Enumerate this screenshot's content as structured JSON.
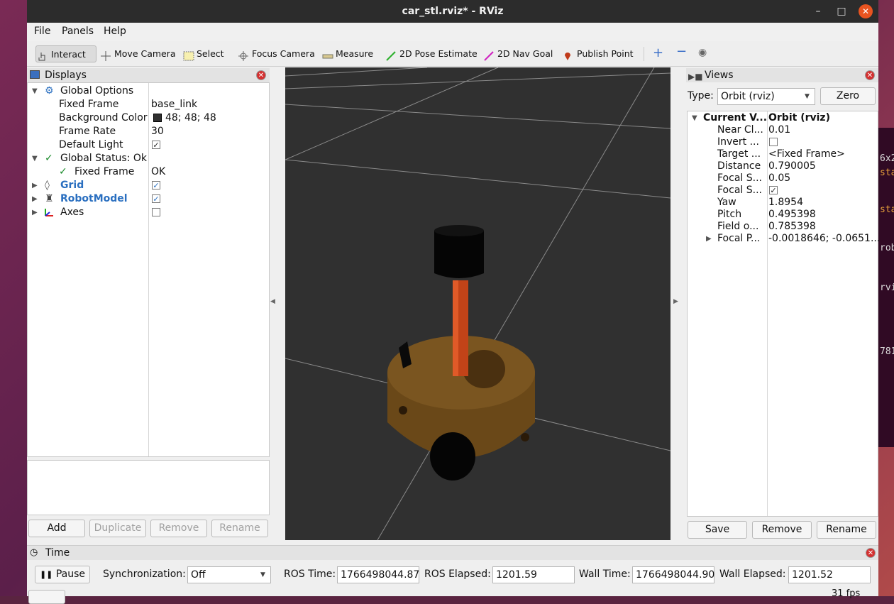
{
  "window": {
    "title": "car_stl.rviz* - RViz"
  },
  "menu": [
    "File",
    "Panels",
    "Help"
  ],
  "toolbar": {
    "interact": "Interact",
    "move_camera": "Move Camera",
    "select": "Select",
    "focus_camera": "Focus Camera",
    "measure": "Measure",
    "pose_estimate": "2D Pose Estimate",
    "nav_goal": "2D Nav Goal",
    "publish_point": "Publish Point"
  },
  "displays": {
    "title": "Displays",
    "rows": [
      {
        "label": "Global Options",
        "value": ""
      },
      {
        "label": "Fixed Frame",
        "value": "base_link"
      },
      {
        "label": "Background Color",
        "value": "48; 48; 48"
      },
      {
        "label": "Frame Rate",
        "value": "30"
      },
      {
        "label": "Default Light",
        "value": "✓"
      },
      {
        "label": "Global Status: Ok",
        "value": ""
      },
      {
        "label": "Fixed Frame",
        "value": "OK"
      },
      {
        "label": "Grid",
        "value": "✓"
      },
      {
        "label": "RobotModel",
        "value": "✓"
      },
      {
        "label": "Axes",
        "value": ""
      }
    ],
    "buttons": {
      "add": "Add",
      "duplicate": "Duplicate",
      "remove": "Remove",
      "rename": "Rename"
    }
  },
  "views": {
    "title": "Views",
    "type_label": "Type:",
    "type_value": "Orbit (rviz)",
    "zero": "Zero",
    "rows": [
      {
        "label": "Current V...",
        "value": "Orbit (rviz)"
      },
      {
        "label": "Near Cl...",
        "value": "0.01"
      },
      {
        "label": "Invert ...",
        "value": ""
      },
      {
        "label": "Target ...",
        "value": "<Fixed Frame>"
      },
      {
        "label": "Distance",
        "value": "0.790005"
      },
      {
        "label": "Focal S...",
        "value": "0.05"
      },
      {
        "label": "Focal S...",
        "value": "✓"
      },
      {
        "label": "Yaw",
        "value": "1.8954"
      },
      {
        "label": "Pitch",
        "value": "0.495398"
      },
      {
        "label": "Field o...",
        "value": "0.785398"
      },
      {
        "label": "Focal P...",
        "value": "-0.0018646; -0.0651..."
      }
    ],
    "buttons": {
      "save": "Save",
      "remove": "Remove",
      "rename": "Rename"
    }
  },
  "time": {
    "title": "Time",
    "pause": "Pause",
    "sync_label": "Synchronization:",
    "sync_value": "Off",
    "ros_time_label": "ROS Time:",
    "ros_time": "1766498044.87",
    "ros_elapsed_label": "ROS Elapsed:",
    "ros_elapsed": "1201.59",
    "wall_time_label": "Wall Time:",
    "wall_time": "1766498044.90",
    "wall_elapsed_label": "Wall Elapsed:",
    "wall_elapsed": "1201.52",
    "fps": "31 fps"
  },
  "terminal": [
    "6x2",
    "sta",
    "sta",
    "rob",
    "rvi",
    "781"
  ],
  "colors": {
    "viewport_bg": "#303030",
    "link_blue": "#2a6fc0",
    "robot_body": "#6b4a1a",
    "mast": "#c0401a",
    "close_red": "#e95420"
  }
}
